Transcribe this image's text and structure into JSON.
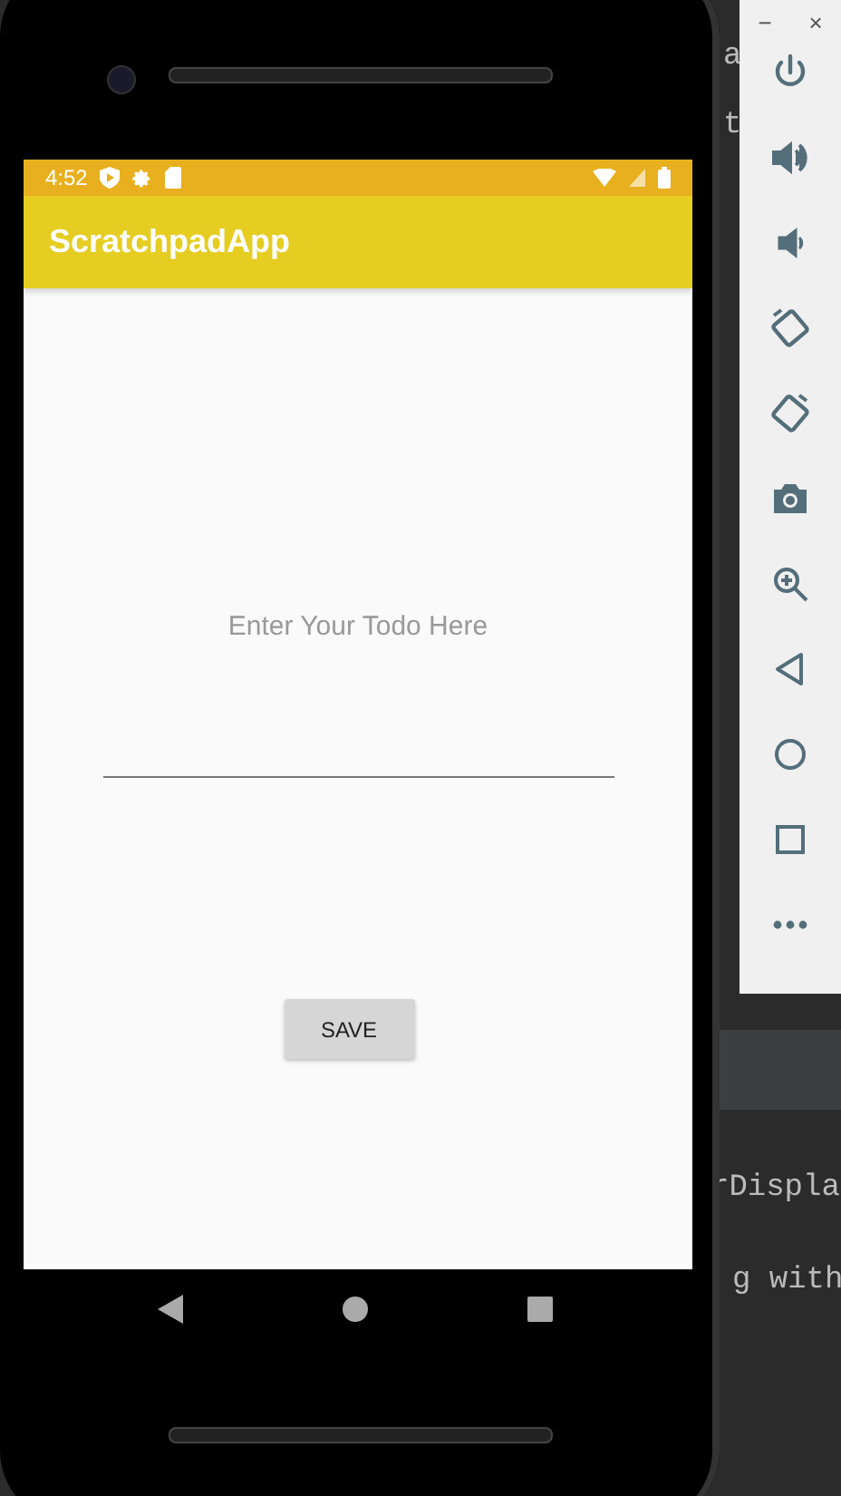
{
  "ide": {
    "code_fragments": [
      "a",
      "t",
      "rDispla",
      "g with"
    ]
  },
  "phone": {
    "status_bar": {
      "time": "4:52"
    },
    "app_bar": {
      "title": "ScratchpadApp"
    },
    "todo_field": {
      "placeholder": "Enter Your Todo Here"
    },
    "save_button": {
      "label": "SAVE"
    }
  },
  "emulator_toolbar": {
    "window_controls": [
      "−",
      "×"
    ]
  }
}
